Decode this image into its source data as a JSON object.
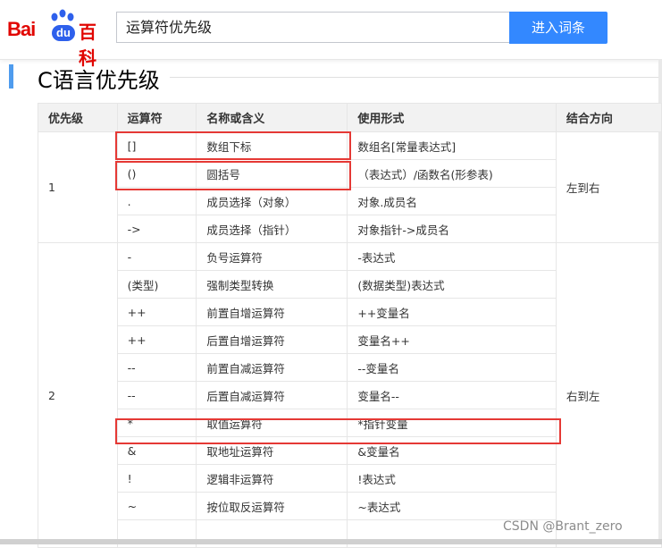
{
  "header": {
    "logo_bai": "Bai",
    "logo_du": "du",
    "logo_baike": "百科",
    "search_value": "运算符优先级",
    "search_button": "进入词条"
  },
  "section": {
    "title": "C语言优先级"
  },
  "table": {
    "headers": [
      "优先级",
      "运算符",
      "名称或含义",
      "使用形式",
      "结合方向"
    ],
    "groups": [
      {
        "priority": "1",
        "direction": "左到右",
        "rows": [
          {
            "op": "[]",
            "name": "数组下标",
            "usage": "数组名[常量表达式]"
          },
          {
            "op": "()",
            "name": "圆括号",
            "usage": "（表达式）/函数名(形参表)"
          },
          {
            "op": ".",
            "name": "成员选择（对象）",
            "usage": "对象.成员名"
          },
          {
            "op": "->",
            "name": "成员选择（指针）",
            "usage": "对象指针->成员名"
          }
        ]
      },
      {
        "priority": "2",
        "direction": "右到左",
        "rows": [
          {
            "op": "-",
            "name": "负号运算符",
            "usage": "-表达式"
          },
          {
            "op": "(类型)",
            "name": "强制类型转换",
            "usage": "(数据类型)表达式"
          },
          {
            "op": "++",
            "name": "前置自增运算符",
            "usage": "++变量名"
          },
          {
            "op": "++",
            "name": "后置自增运算符",
            "usage": "变量名++"
          },
          {
            "op": "--",
            "name": "前置自减运算符",
            "usage": "--变量名"
          },
          {
            "op": "--",
            "name": "后置自减运算符",
            "usage": "变量名--"
          },
          {
            "op": "*",
            "name": "取值运算符",
            "usage": "*指针变量"
          },
          {
            "op": "&",
            "name": "取地址运算符",
            "usage": "&变量名"
          },
          {
            "op": "!",
            "name": "逻辑非运算符",
            "usage": "!表达式"
          },
          {
            "op": "~",
            "name": "按位取反运算符",
            "usage": "~表达式"
          }
        ]
      }
    ]
  },
  "watermark": "CSDN @Brant_zero",
  "colors": {
    "accent": "#3388ff",
    "highlight": "#e53935",
    "brand_red": "#e10602",
    "brand_blue": "#2e60ec"
  }
}
